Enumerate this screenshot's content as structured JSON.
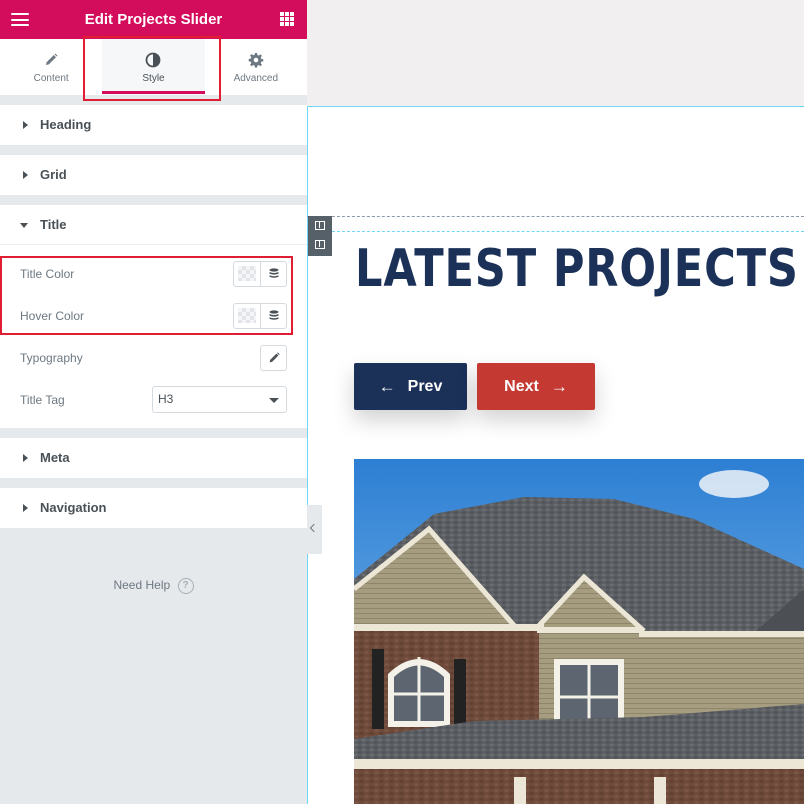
{
  "topbar": {
    "title": "Edit Projects Slider",
    "menu_icon": "hamburger-icon",
    "widgets_icon": "grid-icon"
  },
  "tabs": [
    {
      "label": "Content",
      "icon": "pencil-icon",
      "active": false
    },
    {
      "label": "Style",
      "icon": "contrast-icon",
      "active": true
    },
    {
      "label": "Advanced",
      "icon": "gear-icon",
      "active": false
    }
  ],
  "sections": {
    "heading": "Heading",
    "grid": "Grid",
    "title": "Title",
    "meta": "Meta",
    "navigation": "Navigation"
  },
  "title_controls": {
    "title_color_label": "Title Color",
    "hover_color_label": "Hover Color",
    "typography_label": "Typography",
    "title_tag_label": "Title Tag",
    "title_tag_value": "H3"
  },
  "footer": {
    "need_help": "Need Help",
    "help_glyph": "?"
  },
  "preview": {
    "heading": "LATEST PROJECTS",
    "prev_label": "Prev",
    "next_label": "Next",
    "prev_arrow": "←",
    "next_arrow": "→"
  },
  "colors": {
    "brand": "#d30c5c",
    "navy": "#1b3158",
    "red": "#c43a33",
    "highlight": "#e01e33"
  }
}
